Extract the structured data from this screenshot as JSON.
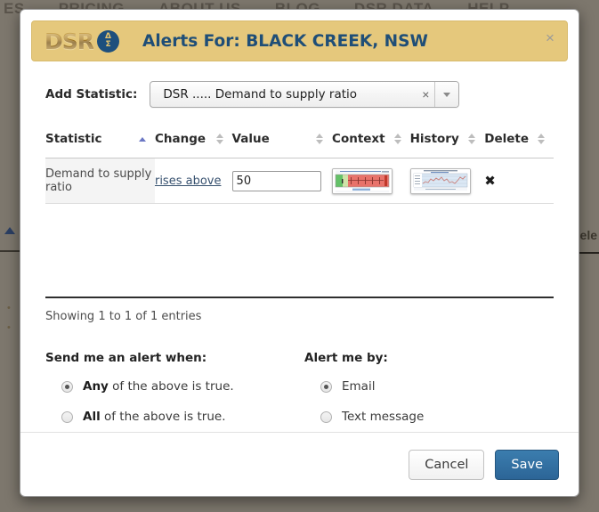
{
  "background": {
    "nav_items": [
      "ES",
      "PRICING",
      "ABOUT US",
      "BLOG",
      "DSR DATA",
      "HELP"
    ],
    "right_text": "ele",
    "tick_marks": "•"
  },
  "modal": {
    "logo_text": "DSR",
    "logo_badge_top": "Δ",
    "logo_badge_bottom": "Σ",
    "title": "Alerts For: BLACK CREEK, NSW",
    "close_icon": "×",
    "header_bg": "#e5c87c",
    "title_color": "#1f4e77"
  },
  "add_statistic": {
    "label": "Add Statistic:",
    "selected_value": "DSR ..... Demand to supply ratio",
    "clear_icon": "×",
    "dropdown_icon": "caret-down-icon"
  },
  "table": {
    "columns": [
      {
        "label": "Statistic",
        "sort": "asc"
      },
      {
        "label": "Change",
        "sort": "both"
      },
      {
        "label": "Value",
        "sort": "both"
      },
      {
        "label": "Context",
        "sort": "both"
      },
      {
        "label": "History",
        "sort": "both"
      },
      {
        "label": "Delete",
        "sort": "both"
      }
    ],
    "rows": [
      {
        "statistic": "Demand to supply ratio",
        "change": "rises above",
        "value": "50",
        "context_icon": "context-chart-thumbnail",
        "history_icon": "history-chart-thumbnail",
        "delete_icon": "✖"
      }
    ],
    "entries_info": "Showing 1 to 1 of 1 entries"
  },
  "options": {
    "left_heading": "Send me an alert when:",
    "left_choices": [
      {
        "bold": "Any",
        "rest": " of the above is true.",
        "checked": true
      },
      {
        "bold": "All",
        "rest": " of the above is true.",
        "checked": false
      }
    ],
    "right_heading": "Alert me by:",
    "right_choices": [
      {
        "bold": "",
        "rest": "Email",
        "checked": true
      },
      {
        "bold": "",
        "rest": "Text message",
        "checked": false
      }
    ]
  },
  "footer": {
    "cancel_label": "Cancel",
    "save_label": "Save",
    "save_color": "#2c6597"
  }
}
